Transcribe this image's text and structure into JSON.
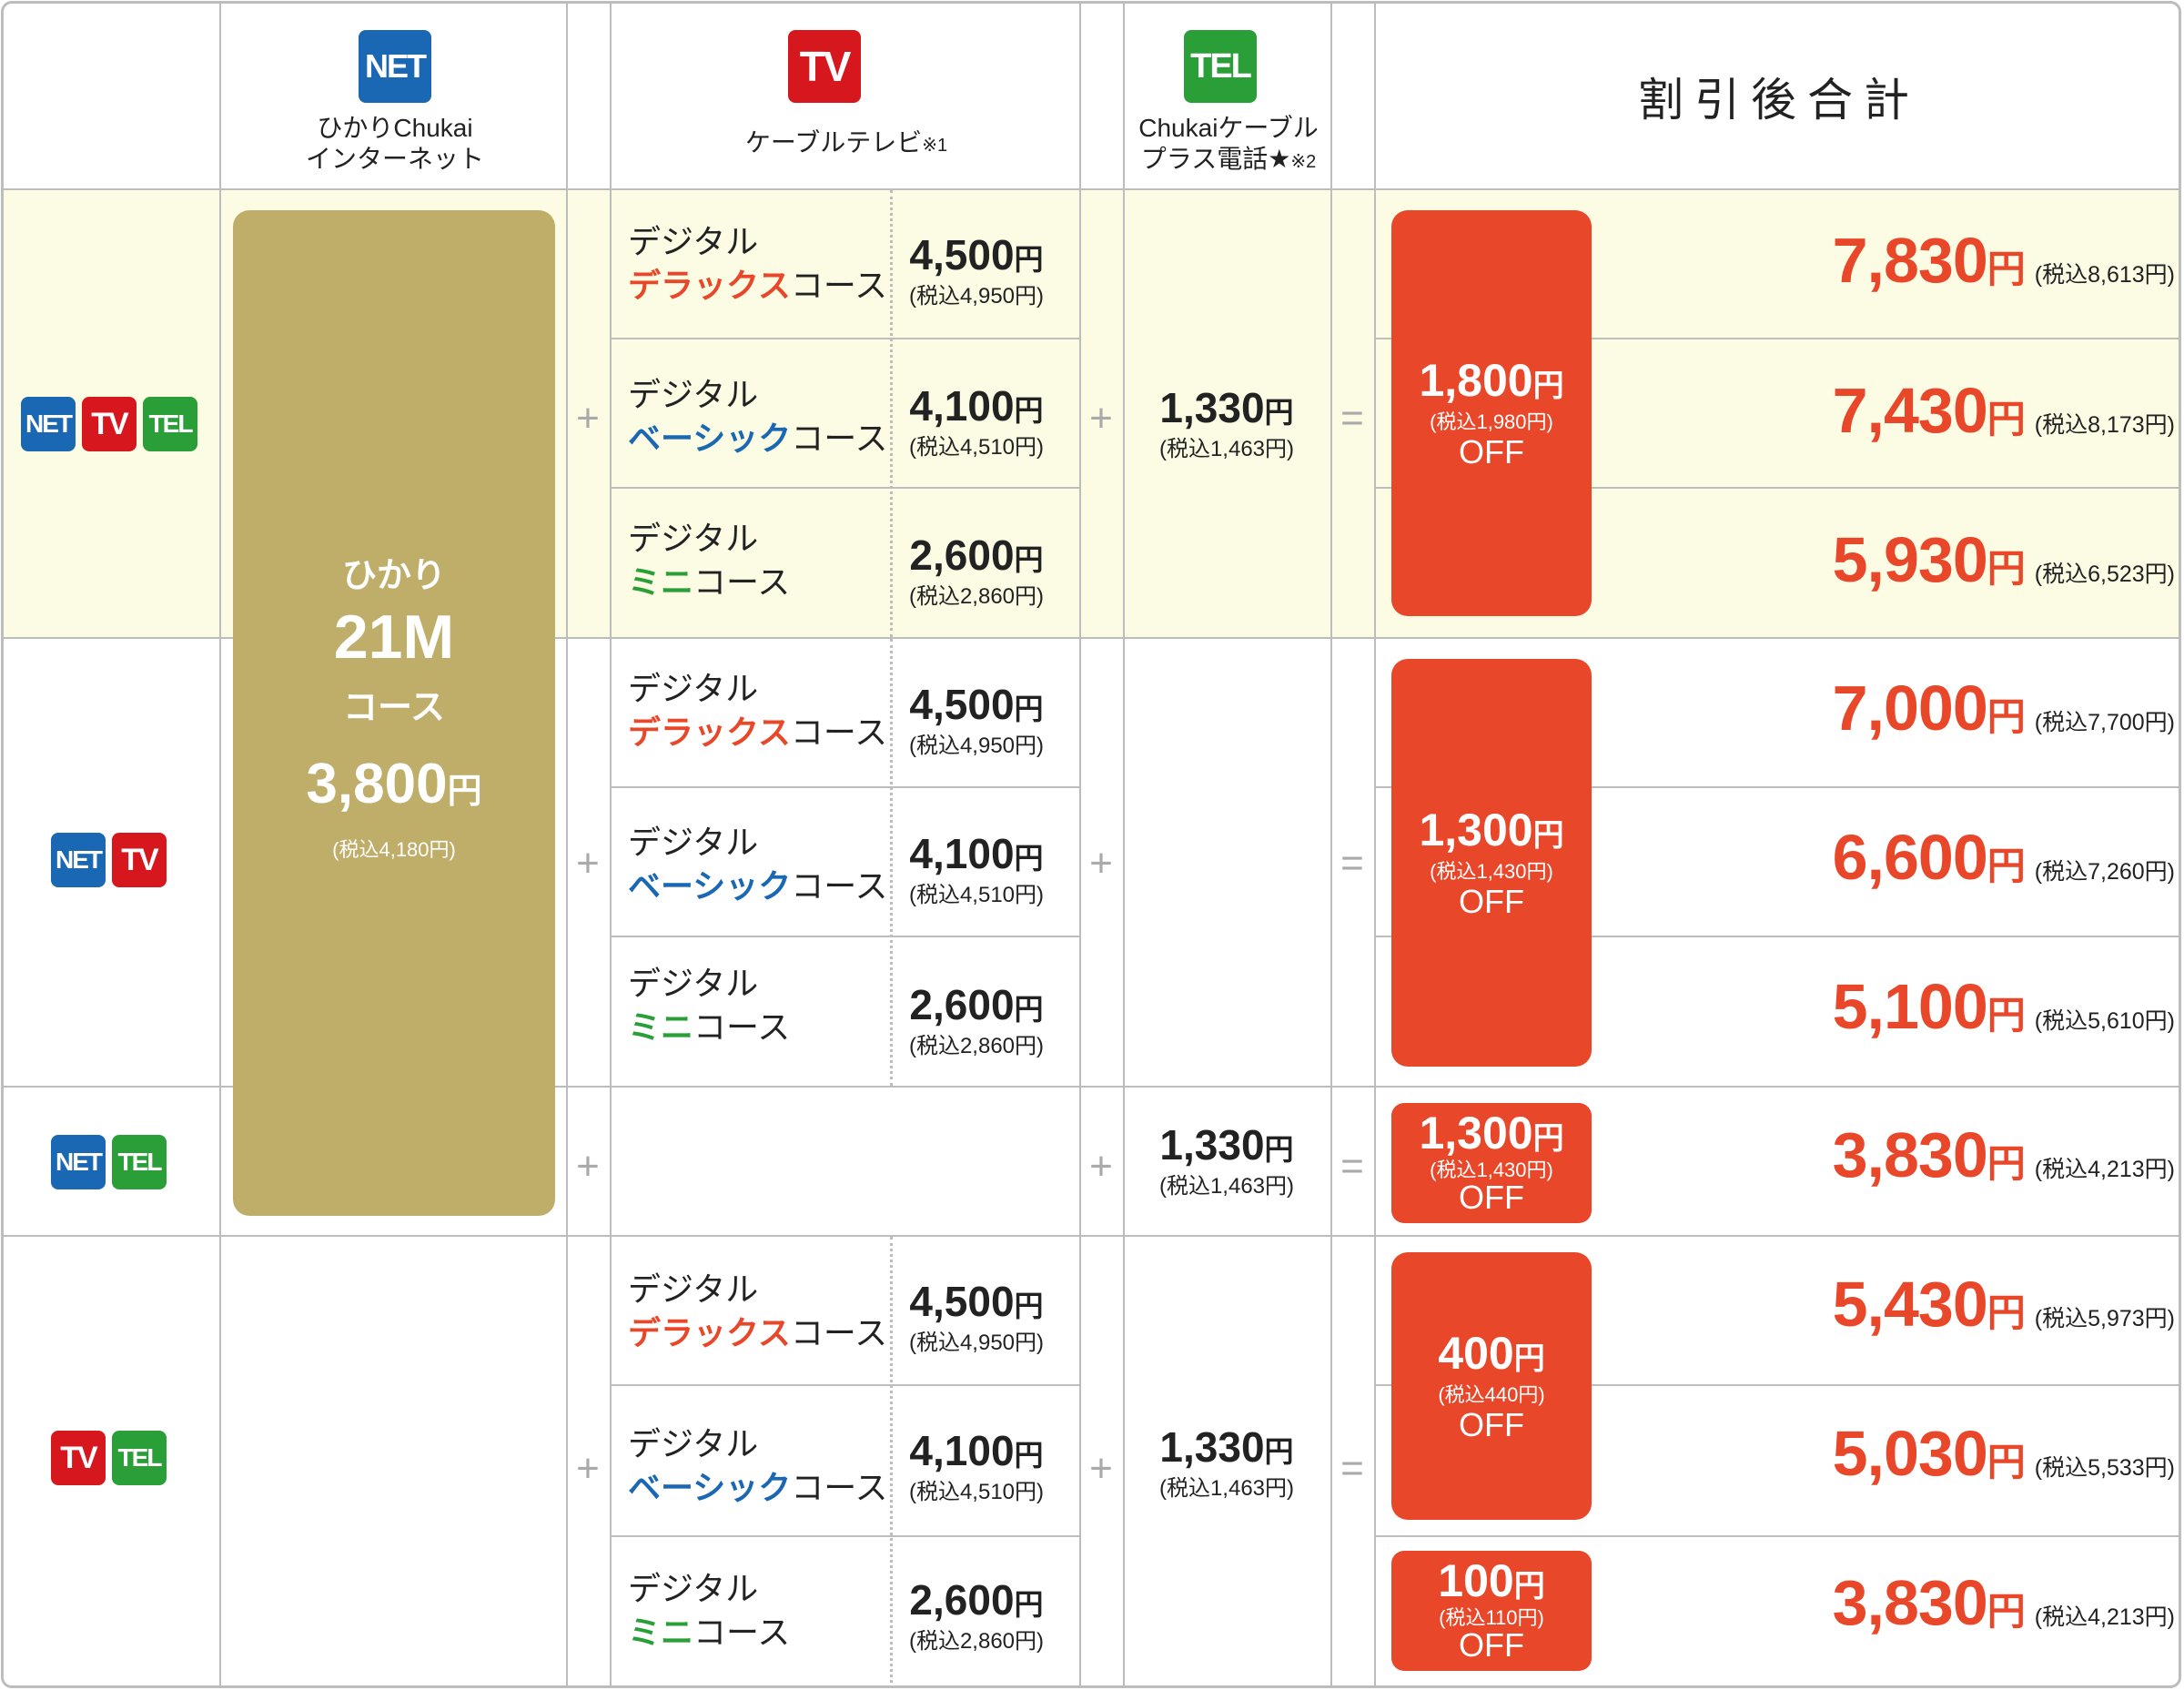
{
  "header": {
    "net": {
      "badge": "NET",
      "line1": "ひかりChukai",
      "line2": "インターネット"
    },
    "tv": {
      "badge": "TV",
      "label": "ケーブルテレビ",
      "note": "※1"
    },
    "tel": {
      "badge": "TEL",
      "line1": "Chukaiケーブル",
      "line2": "プラス電話★",
      "note": "※2"
    },
    "total_label": "割引後合計"
  },
  "internet_plan": {
    "line1": "ひかり",
    "line2": "21M",
    "line3": "コース",
    "price": "3,800",
    "unit": "円",
    "tax": "(税込4,180円)"
  },
  "operators": {
    "plus": "+",
    "equals": "="
  },
  "courses": [
    {
      "prefix": "デジタル",
      "name_colored": "デラックス",
      "suffix": "コース",
      "color": "#e8472a",
      "price": "4,500",
      "unit": "円",
      "tax": "(税込4,950円)"
    },
    {
      "prefix": "デジタル",
      "name_colored": "ベーシック",
      "suffix": "コース",
      "color": "#1a68b3",
      "price": "4,100",
      "unit": "円",
      "tax": "(税込4,510円)"
    },
    {
      "prefix": "デジタル",
      "name_colored": "ミニ",
      "suffix": "コース",
      "color": "#2a9f37",
      "price": "2,600",
      "unit": "円",
      "tax": "(税込2,860円)"
    }
  ],
  "tel_price": {
    "price": "1,330",
    "unit": "円",
    "tax": "(税込1,463円)"
  },
  "groups": [
    {
      "badges": [
        "NET",
        "TV",
        "TEL"
      ],
      "discounts": [
        {
          "amount": "1,800",
          "unit": "円",
          "tax": "(税込1,980円)",
          "label": "OFF"
        }
      ],
      "totals": [
        {
          "value": "7,830",
          "unit": "円",
          "tax": "(税込8,613円)"
        },
        {
          "value": "7,430",
          "unit": "円",
          "tax": "(税込8,173円)"
        },
        {
          "value": "5,930",
          "unit": "円",
          "tax": "(税込6,523円)"
        }
      ]
    },
    {
      "badges": [
        "NET",
        "TV"
      ],
      "discounts": [
        {
          "amount": "1,300",
          "unit": "円",
          "tax": "(税込1,430円)",
          "label": "OFF"
        }
      ],
      "totals": [
        {
          "value": "7,000",
          "unit": "円",
          "tax": "(税込7,700円)"
        },
        {
          "value": "6,600",
          "unit": "円",
          "tax": "(税込7,260円)"
        },
        {
          "value": "5,100",
          "unit": "円",
          "tax": "(税込5,610円)"
        }
      ]
    },
    {
      "badges": [
        "NET",
        "TEL"
      ],
      "discounts": [
        {
          "amount": "1,300",
          "unit": "円",
          "tax": "(税込1,430円)",
          "label": "OFF"
        }
      ],
      "totals": [
        {
          "value": "3,830",
          "unit": "円",
          "tax": "(税込4,213円)"
        }
      ]
    },
    {
      "badges": [
        "TV",
        "TEL"
      ],
      "discounts": [
        {
          "amount": "400",
          "unit": "円",
          "tax": "(税込440円)",
          "label": "OFF"
        },
        {
          "amount": "100",
          "unit": "円",
          "tax": "(税込110円)",
          "label": "OFF"
        }
      ],
      "totals": [
        {
          "value": "5,430",
          "unit": "円",
          "tax": "(税込5,973円)"
        },
        {
          "value": "5,030",
          "unit": "円",
          "tax": "(税込5,533円)"
        },
        {
          "value": "3,830",
          "unit": "円",
          "tax": "(税込4,213円)"
        }
      ]
    }
  ],
  "colors": {
    "net": "#1a68b3",
    "tv": "#d6171d",
    "tel": "#2a9f37",
    "accent": "#e8472a",
    "gold": "#bfae6a",
    "highlight_row": "#fcfbe3"
  }
}
